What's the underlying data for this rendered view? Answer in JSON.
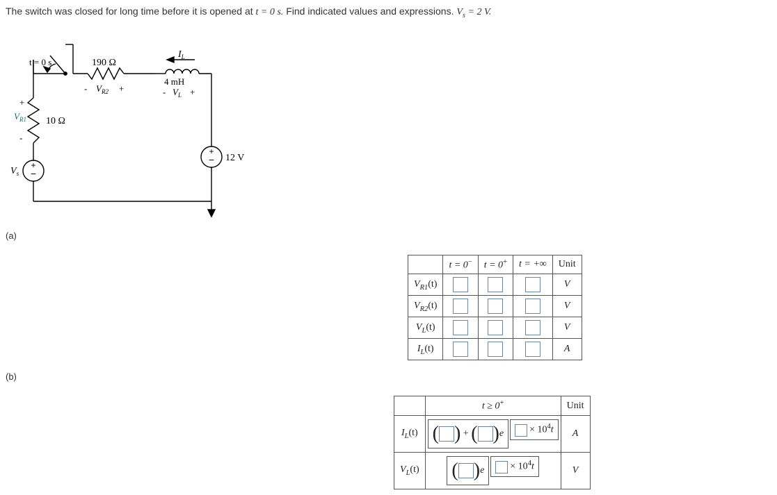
{
  "problem": {
    "pre": "The switch was closed for long time before it is opened at ",
    "t_eq": "t = 0 s.",
    "mid": " Find indicated values and expressions. ",
    "vs_eq": "V",
    "vs_sub": "s",
    "vs_rest": " = 2 V."
  },
  "circuit": {
    "switch_label": "t = 0 s",
    "r2_val": "190 Ω",
    "vr2_label": "V",
    "vr2_sub": "R2",
    "il_label": "I",
    "il_sub": "L",
    "ind_val": "4 mH",
    "vl_label": "V",
    "vl_sub": "L",
    "r1_val": "10 Ω",
    "vr1_label": "V",
    "vr1_sub": "R1",
    "vs_label": "V",
    "vs_sub": "s",
    "src_right": "12 V"
  },
  "part_a": "(a)",
  "part_b": "(b)",
  "table_a": {
    "h1": "t = 0",
    "h1_sup": "−",
    "h2": "t = 0",
    "h2_sup": "+",
    "h3": "t = +∞",
    "h4": "Unit",
    "rows": [
      {
        "label": "V",
        "sub": "R1",
        "arg": "(t)",
        "unit": "V"
      },
      {
        "label": "V",
        "sub": "R2",
        "arg": "(t)",
        "unit": "V"
      },
      {
        "label": "V",
        "sub": "L",
        "arg": "(t)",
        "unit": "V"
      },
      {
        "label": "I",
        "sub": "L",
        "arg": "(t)",
        "unit": "A"
      }
    ]
  },
  "table_b": {
    "header": "t ≥ 0",
    "header_sup": "+",
    "unit_hdr": "Unit",
    "rows": [
      {
        "label": "I",
        "sub": "L",
        "arg": "(t)",
        "unit": "A",
        "type": "sum"
      },
      {
        "label": "V",
        "sub": "L",
        "arg": "(t)",
        "unit": "V",
        "type": "single"
      }
    ],
    "plus": "+",
    "e": "e",
    "exp_prefix": "× 10",
    "exp_sup": "4",
    "exp_t": "t"
  }
}
